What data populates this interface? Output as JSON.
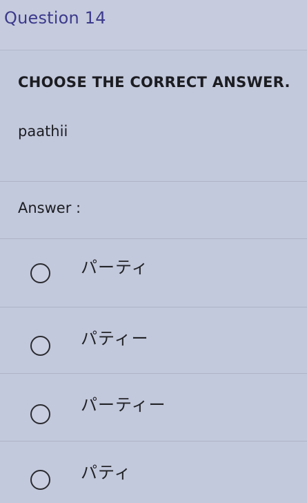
{
  "question": {
    "number_label": "Question 14",
    "instruction": "CHOOSE THE CORRECT ANSWER.",
    "prompt": "paathii",
    "answer_label": "Answer :"
  },
  "options": [
    {
      "label": "パーティ",
      "selected": false
    },
    {
      "label": "パティー",
      "selected": false
    },
    {
      "label": "パーティー",
      "selected": false
    },
    {
      "label": "パティ",
      "selected": false
    }
  ]
}
